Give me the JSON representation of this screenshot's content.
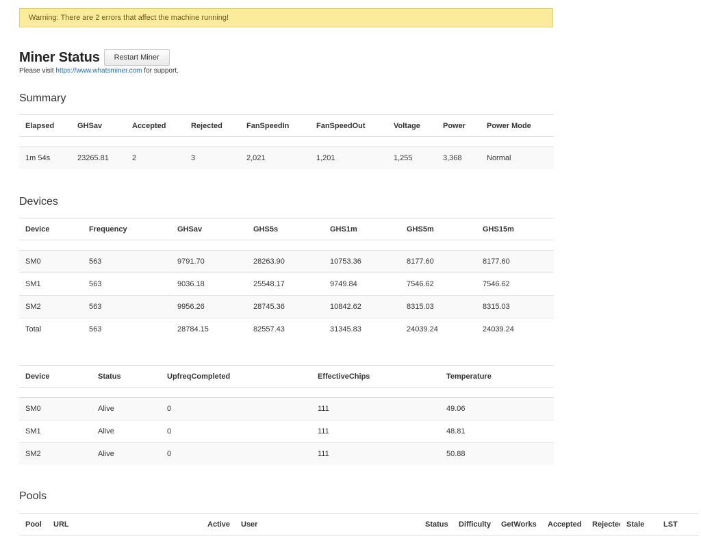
{
  "warning": {
    "text": "Warning: There are 2 errors that affect the machine running!"
  },
  "header": {
    "title": "Miner Status",
    "restart_label": "Restart Miner",
    "support_prefix": "Please visit ",
    "support_link": "https://www.whatsminer.com",
    "support_suffix": " for support."
  },
  "summary": {
    "title": "Summary",
    "columns": [
      "Elapsed",
      "GHSav",
      "Accepted",
      "Rejected",
      "FanSpeedIn",
      "FanSpeedOut",
      "Voltage",
      "Power",
      "Power Mode"
    ],
    "rows": [
      [
        "1m 54s",
        "23265.81",
        "2",
        "3",
        "2,021",
        "1,201",
        "1,255",
        "3,368",
        "Normal"
      ]
    ]
  },
  "devices": {
    "title": "Devices",
    "columns": [
      "Device",
      "Frequency",
      "GHSav",
      "GHS5s",
      "GHS1m",
      "GHS5m",
      "GHS15m"
    ],
    "rows": [
      [
        "SM0",
        "563",
        "9791.70",
        "28263.90",
        "10753.36",
        "8177.60",
        "8177.60"
      ],
      [
        "SM1",
        "563",
        "9036.18",
        "25548.17",
        "9749.84",
        "7546.62",
        "7546.62"
      ],
      [
        "SM2",
        "563",
        "9956.26",
        "28745.36",
        "10842.62",
        "8315.03",
        "8315.03"
      ],
      [
        "Total",
        "563",
        "28784.15",
        "82557.43",
        "31345.83",
        "24039.24",
        "24039.24"
      ]
    ]
  },
  "device_status": {
    "columns": [
      "Device",
      "Status",
      "UpfreqCompleted",
      "EffectiveChips",
      "Temperature"
    ],
    "rows": [
      [
        "SM0",
        "Alive",
        "0",
        "111",
        "49.06"
      ],
      [
        "SM1",
        "Alive",
        "0",
        "111",
        "48.81"
      ],
      [
        "SM2",
        "Alive",
        "0",
        "111",
        "50.88"
      ]
    ]
  },
  "pools": {
    "title": "Pools",
    "columns": [
      "Pool",
      "URL",
      "Active",
      "User",
      "Status",
      "Difficulty",
      "GetWorks",
      "Accepted",
      "Rejected",
      "Stale",
      "LST"
    ]
  }
}
